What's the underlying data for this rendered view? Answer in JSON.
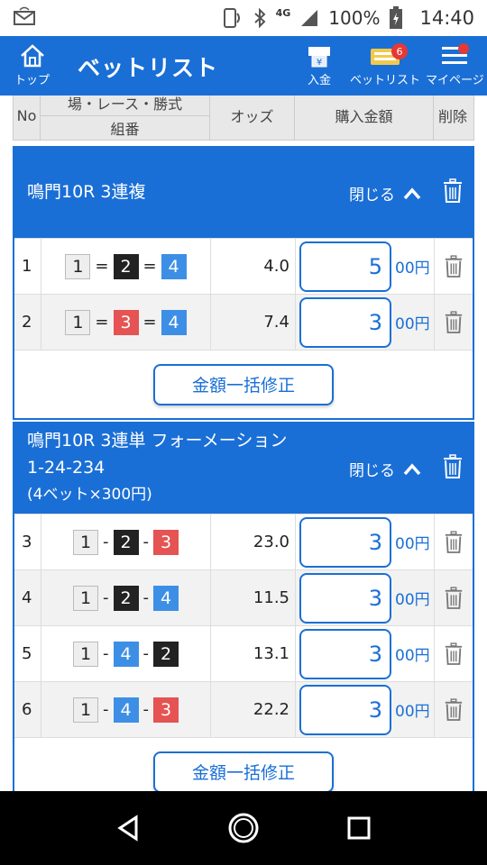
{
  "statusbar": {
    "signal": "4G",
    "battery": "100%",
    "time": "14:40"
  },
  "header": {
    "home_label": "トップ",
    "title": "ベットリスト",
    "deposit_label": "入金",
    "betlist_label": "ベットリスト",
    "betlist_badge": "6",
    "mypage_label": "マイページ"
  },
  "table_header": {
    "no": "No",
    "race": "場・レース・勝式",
    "combo": "組番",
    "odds": "オッズ",
    "amount": "購入金額",
    "delete": "削除"
  },
  "sections": [
    {
      "title": "鳴門10R 3連複",
      "subtitle": "",
      "note": "",
      "close_label": "閉じる",
      "bulk_label": "金額一括修正",
      "rows": [
        {
          "no": "1",
          "n1": "1",
          "s1": "=",
          "n2": "2",
          "s2": "=",
          "n3": "4",
          "odds": "4.0",
          "amount": "5",
          "unit": "00円"
        },
        {
          "no": "2",
          "n1": "1",
          "s1": "=",
          "n2": "3",
          "s2": "=",
          "n3": "4",
          "odds": "7.4",
          "amount": "3",
          "unit": "00円"
        }
      ]
    },
    {
      "title": "鳴門10R 3連単 フォーメーション",
      "subtitle": "1-24-234",
      "note": "(4ベット×300円)",
      "close_label": "閉じる",
      "bulk_label": "金額一括修正",
      "rows": [
        {
          "no": "3",
          "n1": "1",
          "s1": "-",
          "n2": "2",
          "s2": "-",
          "n3": "3",
          "odds": "23.0",
          "amount": "3",
          "unit": "00円"
        },
        {
          "no": "4",
          "n1": "1",
          "s1": "-",
          "n2": "2",
          "s2": "-",
          "n3": "4",
          "odds": "11.5",
          "amount": "3",
          "unit": "00円"
        },
        {
          "no": "5",
          "n1": "1",
          "s1": "-",
          "n2": "4",
          "s2": "-",
          "n3": "2",
          "odds": "13.1",
          "amount": "3",
          "unit": "00円"
        },
        {
          "no": "6",
          "n1": "1",
          "s1": "-",
          "n2": "4",
          "s2": "-",
          "n3": "3",
          "odds": "22.2",
          "amount": "3",
          "unit": "00円"
        }
      ]
    }
  ],
  "colors": {
    "accent": "#1a6fd6",
    "boat1": "#eeeeee",
    "boat2": "#222222",
    "boat3": "#e55353",
    "boat4": "#3d8fe6"
  }
}
